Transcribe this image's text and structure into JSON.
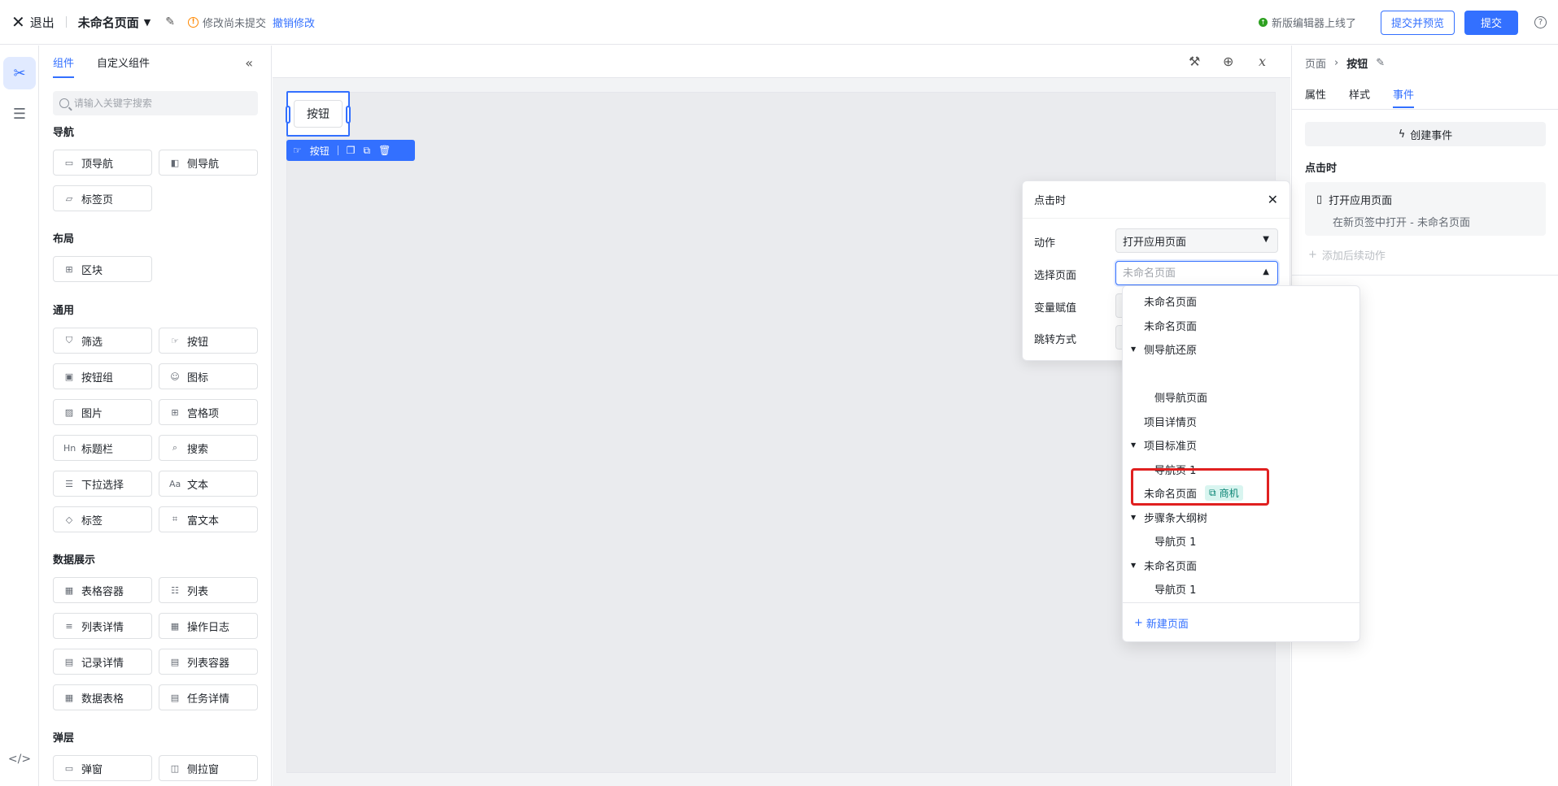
{
  "header": {
    "exit_label": "退出",
    "page_title": "未命名页面",
    "unsaved_text": "修改尚未提交",
    "undo_label": "撤销修改",
    "notice_text": "新版编辑器上线了",
    "submit_preview_label": "提交并预览",
    "submit_label": "提交"
  },
  "panel": {
    "tabs": [
      "组件",
      "自定义组件"
    ],
    "search_placeholder": "请输入关键字搜索",
    "sections": [
      {
        "title": "导航",
        "items": [
          {
            "label": "顶导航",
            "icon": "top-nav-icon"
          },
          {
            "label": "侧导航",
            "icon": "side-nav-icon"
          },
          {
            "label": "标签页",
            "icon": "folder-icon"
          }
        ]
      },
      {
        "title": "布局",
        "items": [
          {
            "label": "区块",
            "icon": "grid-icon"
          }
        ]
      },
      {
        "title": "通用",
        "items": [
          {
            "label": "筛选",
            "icon": "filter-icon"
          },
          {
            "label": "按钮",
            "icon": "button-icon"
          },
          {
            "label": "按钮组",
            "icon": "button-group-icon"
          },
          {
            "label": "图标",
            "icon": "smile-icon"
          },
          {
            "label": "图片",
            "icon": "image-icon"
          },
          {
            "label": "宫格项",
            "icon": "grid-item-icon"
          },
          {
            "label": "标题栏",
            "icon": "heading-icon"
          },
          {
            "label": "搜索",
            "icon": "search-icon"
          },
          {
            "label": "下拉选择",
            "icon": "list-icon"
          },
          {
            "label": "文本",
            "icon": "text-icon"
          },
          {
            "label": "标签",
            "icon": "tag-icon"
          },
          {
            "label": "富文本",
            "icon": "rich-text-icon"
          }
        ]
      },
      {
        "title": "数据展示",
        "items": [
          {
            "label": "表格容器",
            "icon": "table-icon"
          },
          {
            "label": "列表",
            "icon": "list-icon"
          },
          {
            "label": "列表详情",
            "icon": "list-detail-icon"
          },
          {
            "label": "操作日志",
            "icon": "log-icon"
          },
          {
            "label": "记录详情",
            "icon": "record-icon"
          },
          {
            "label": "列表容器",
            "icon": "list-container-icon"
          },
          {
            "label": "数据表格",
            "icon": "data-table-icon"
          },
          {
            "label": "任务详情",
            "icon": "task-icon"
          }
        ]
      },
      {
        "title": "弹层",
        "items": [
          {
            "label": "弹窗",
            "icon": "modal-icon"
          },
          {
            "label": "侧拉窗",
            "icon": "drawer-icon"
          }
        ]
      }
    ]
  },
  "canvas": {
    "button_label": "按钮",
    "toolbar_label": "按钮"
  },
  "right_panel": {
    "crumb_parent": "页面",
    "crumb_current": "按钮",
    "tabs": [
      "属性",
      "样式",
      "事件"
    ],
    "create_event_label": "创建事件",
    "event_title": "点击时",
    "event_action": "打开应用页面",
    "event_detail": "在新页签中打开 - 未命名页面",
    "add_follow_label": "添加后续动作"
  },
  "popup": {
    "title": "点击时",
    "rows": [
      {
        "label": "动作",
        "value": "打开应用页面"
      },
      {
        "label": "选择页面",
        "placeholder": "未命名页面"
      },
      {
        "label": "变量赋值"
      },
      {
        "label": "跳转方式"
      }
    ]
  },
  "dropdown": {
    "items": [
      {
        "label": "未命名页面",
        "level": 0,
        "caret": false
      },
      {
        "label": "未命名页面",
        "level": 0,
        "caret": false
      },
      {
        "label": "侧导航还原",
        "level": 0,
        "caret": true
      },
      {
        "label": "",
        "level": 1,
        "caret": false
      },
      {
        "label": "侧导航页面",
        "level": 1,
        "caret": false
      },
      {
        "label": "项目详情页",
        "level": 0,
        "caret": false
      },
      {
        "label": "项目标准页",
        "level": 0,
        "caret": true
      },
      {
        "label": "导航页 1",
        "level": 1,
        "caret": false
      },
      {
        "label": "未命名页面",
        "level": 0,
        "caret": false,
        "tag": "商机"
      },
      {
        "label": "步骤条大纲树",
        "level": 0,
        "caret": true
      },
      {
        "label": "导航页 1",
        "level": 1,
        "caret": false
      },
      {
        "label": "未命名页面",
        "level": 0,
        "caret": true
      },
      {
        "label": "导航页 1",
        "level": 1,
        "caret": false
      }
    ],
    "new_page_label": "新建页面"
  }
}
